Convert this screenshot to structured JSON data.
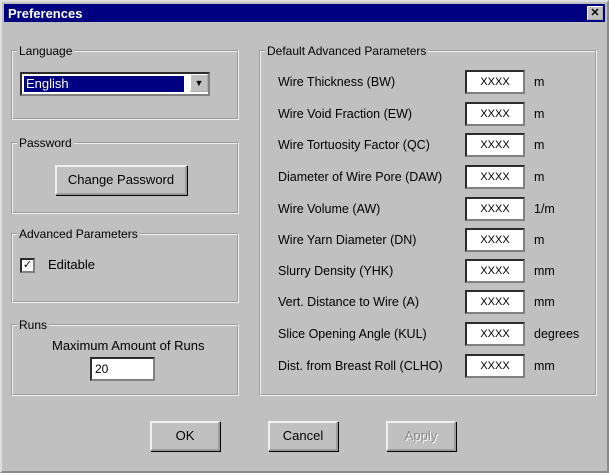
{
  "window": {
    "title": "Preferences",
    "close_glyph": "✕"
  },
  "language": {
    "group_label": "Language",
    "selected": "English",
    "arrow_icon": "chevron-down-icon",
    "arrow_glyph": "▼"
  },
  "password": {
    "group_label": "Password",
    "change_label": "Change Password"
  },
  "advanced": {
    "group_label": "Advanced Parameters",
    "editable_label": "Editable",
    "editable_checked": true,
    "check_glyph": "✓"
  },
  "runs": {
    "group_label": "Runs",
    "max_label": "Maximum Amount of Runs",
    "max_value": "20"
  },
  "defaults": {
    "group_label": "Default Advanced Parameters",
    "params": [
      {
        "label": "Wire Thickness (BW)",
        "value": "XXXX",
        "unit": "m"
      },
      {
        "label": "Wire Void Fraction (EW)",
        "value": "XXXX",
        "unit": "m"
      },
      {
        "label": "Wire Tortuosity Factor (QC)",
        "value": "XXXX",
        "unit": "m"
      },
      {
        "label": "Diameter of Wire Pore (DAW)",
        "value": "XXXX",
        "unit": "m"
      },
      {
        "label": "Wire Volume (AW)",
        "value": "XXXX",
        "unit": "1/m"
      },
      {
        "label": "Wire Yarn Diameter (DN)",
        "value": "XXXX",
        "unit": "m"
      },
      {
        "label": "Slurry Density (YHK)",
        "value": "XXXX",
        "unit": "mm"
      },
      {
        "label": "Vert. Distance to Wire (A)",
        "value": "XXXX",
        "unit": "mm"
      },
      {
        "label": "Slice Opening Angle (KUL)",
        "value": "XXXX",
        "unit": "degrees"
      },
      {
        "label": "Dist. from Breast Roll (CLHO)",
        "value": "XXXX",
        "unit": "mm"
      }
    ]
  },
  "buttons": {
    "ok": "OK",
    "cancel": "Cancel",
    "apply": "Apply"
  }
}
